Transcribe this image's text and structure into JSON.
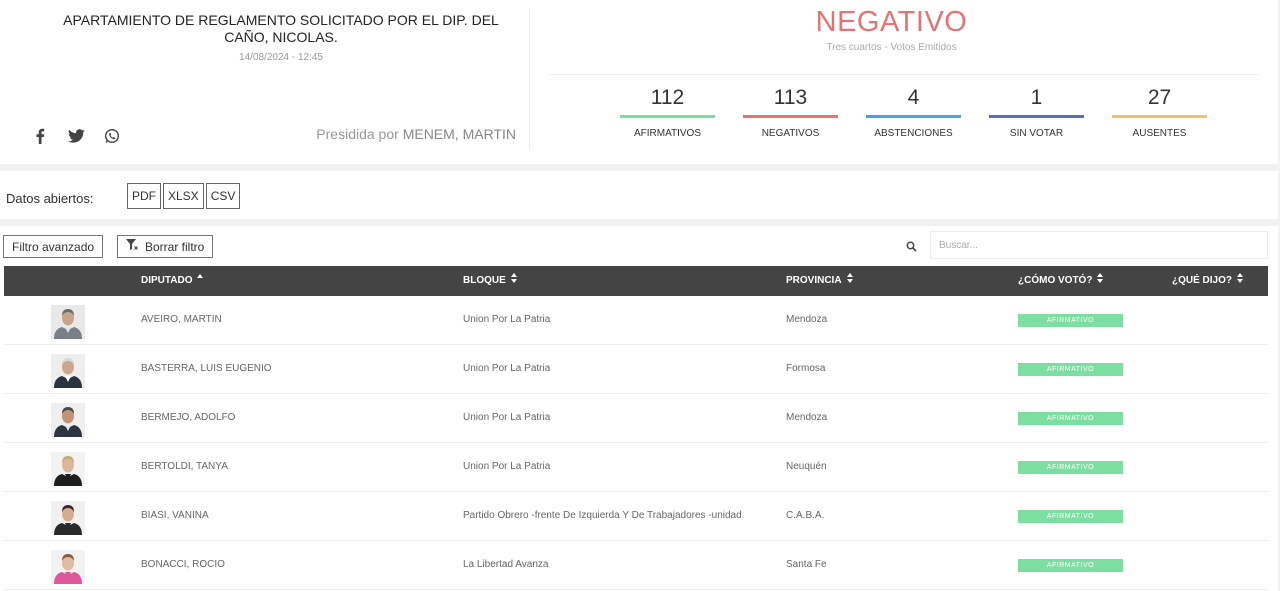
{
  "header": {
    "title": "APARTAMIENTO DE REGLAMENTO SOLICITADO POR EL DIP. DEL CAÑO, NICOLAS.",
    "datetime": "14/08/2024 - 12:45",
    "presided_prefix": "Presidida por",
    "presided_name": "MENEM, MARTIN",
    "share_icons": [
      "facebook-icon",
      "twitter-icon",
      "whatsapp-icon"
    ]
  },
  "result": {
    "label": "NEGATIVO",
    "subtitle": "Tres cuartos - Votos Emitidos",
    "color": "#e57373"
  },
  "counts": [
    {
      "value": "112",
      "label": "AFIRMATIVOS",
      "color": "#7ddea1"
    },
    {
      "value": "113",
      "label": "NEGATIVOS",
      "color": "#e57373"
    },
    {
      "value": "4",
      "label": "ABSTENCIONES",
      "color": "#4aa3df"
    },
    {
      "value": "1",
      "label": "SIN VOTAR",
      "color": "#5b6bbf"
    },
    {
      "value": "27",
      "label": "AUSENTES",
      "color": "#f2c36b"
    }
  ],
  "open_data": {
    "label": "Datos abiertos:",
    "buttons": [
      "PDF",
      "XLSX",
      "CSV"
    ]
  },
  "filters": {
    "advanced": "Filtro avanzado",
    "clear": "Borrar filtro",
    "search_placeholder": "Buscar..."
  },
  "table": {
    "columns": [
      {
        "label": "DIPUTADO",
        "sort": "asc"
      },
      {
        "label": "BLOQUE",
        "sort": "both"
      },
      {
        "label": "PROVINCIA",
        "sort": "both"
      },
      {
        "label": "¿CÓMO VOTÓ?",
        "sort": "both"
      },
      {
        "label": "¿QUÉ DIJO?",
        "sort": "both"
      }
    ],
    "rows": [
      {
        "name": "AVEIRO, MARTIN",
        "bloque": "Union Por La Patria",
        "provincia": "Mendoza",
        "voto": "AFIRMATIVO",
        "photo": {
          "bg": "#e9e9e9",
          "skin": "#c9a48a",
          "hair": "#6b6b6b",
          "suit": "#7a8088",
          "shirt": "#dfe6ee"
        }
      },
      {
        "name": "BASTERRA, LUIS EUGENIO",
        "bloque": "Union Por La Patria",
        "provincia": "Formosa",
        "voto": "AFIRMATIVO",
        "photo": {
          "bg": "#eeeeee",
          "skin": "#cfa68c",
          "hair": "#d9d9d9",
          "suit": "#2c3340",
          "shirt": "#ffffff"
        }
      },
      {
        "name": "BERMEJO, ADOLFO",
        "bloque": "Union Por La Patria",
        "provincia": "Mendoza",
        "voto": "AFIRMATIVO",
        "photo": {
          "bg": "#efefef",
          "skin": "#c49478",
          "hair": "#4a4a4a",
          "suit": "#2e3440",
          "shirt": "#e8ecf2"
        }
      },
      {
        "name": "BERTOLDI, TANYA",
        "bloque": "Union Por La Patria",
        "provincia": "Neuquén",
        "voto": "AFIRMATIVO",
        "photo": {
          "bg": "#f2f2f2",
          "skin": "#dcb79c",
          "hair": "#c8a878",
          "suit": "#1e1e1e",
          "shirt": "#1e1e1e"
        }
      },
      {
        "name": "BIASI, VANINA",
        "bloque": "Partido Obrero -frente De Izquierda Y De Trabajadores -unidad",
        "provincia": "C.A.B.A.",
        "voto": "AFIRMATIVO",
        "photo": {
          "bg": "#f0f0f0",
          "skin": "#d7ab90",
          "hair": "#3a2a22",
          "suit": "#2a2a2a",
          "shirt": "#2a2a2a"
        }
      },
      {
        "name": "BONACCI, ROCIO",
        "bloque": "La Libertad Avanza",
        "provincia": "Santa Fe",
        "voto": "AFIRMATIVO",
        "photo": {
          "bg": "#f2f2f2",
          "skin": "#e0bca2",
          "hair": "#8a5a3a",
          "suit": "#e0569a",
          "shirt": "#e0569a"
        }
      }
    ],
    "vote_color": "#7ddea1"
  }
}
